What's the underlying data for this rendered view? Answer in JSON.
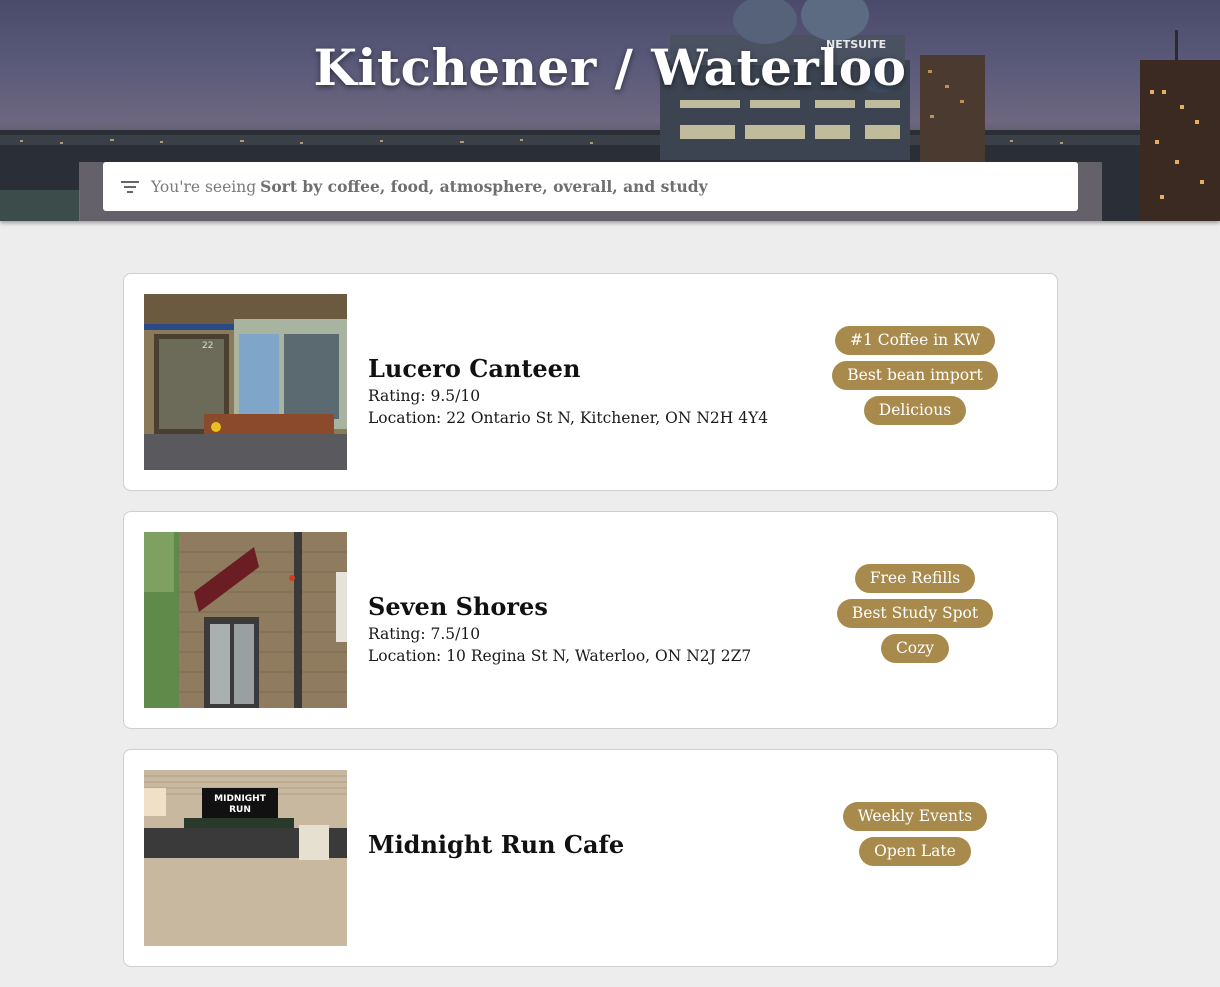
{
  "hero": {
    "title": "Kitchener / Waterloo",
    "sign_text": "NETSUITE"
  },
  "search": {
    "prefix": "You're seeing",
    "value": "Sort by coffee, food, atmosphere, overall, and study",
    "icon": "filter-icon"
  },
  "colors": {
    "tag_bg": "#a88a4d",
    "page_bg": "#ededed",
    "card_bg": "#ffffff"
  },
  "cafes": [
    {
      "name": "Lucero Canteen",
      "rating": "Rating: 9.5/10",
      "location": "Location: 22 Ontario St N, Kitchener, ON N2H 4Y4",
      "tags": [
        "#1 Coffee in KW",
        "Best bean import",
        "Delicious"
      ],
      "photo_text": "22"
    },
    {
      "name": "Seven Shores",
      "rating": "Rating: 7.5/10",
      "location": "Location: 10 Regina St N, Waterloo, ON N2J 2Z7",
      "tags": [
        "Free Refills",
        "Best Study Spot",
        "Cozy"
      ],
      "photo_text": ""
    },
    {
      "name": "Midnight Run Cafe",
      "rating": "",
      "location": "",
      "tags": [
        "Weekly Events",
        "Open Late"
      ],
      "photo_text": "MIDNIGHT RUN"
    }
  ]
}
